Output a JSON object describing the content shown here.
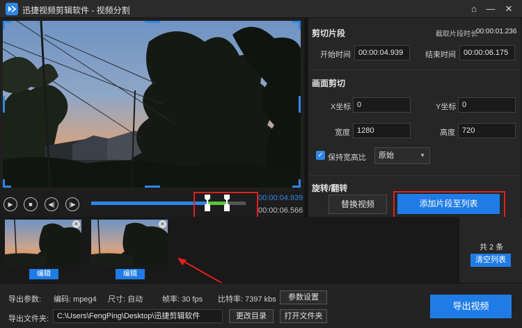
{
  "app": {
    "title": "迅捷视频剪辑软件 - 视频分割",
    "controls": {
      "home_icon": "⌂",
      "min_icon": "—",
      "close_icon": "✕"
    }
  },
  "player": {
    "current_time": "00:00:04.939",
    "end_time": "00:00:06.566",
    "trim_range": {
      "start_fraction": 0.75,
      "end_fraction": 0.88
    }
  },
  "clip_section": {
    "title": "剪切片段",
    "duration_label": "截取片段时长",
    "duration_value": "00:00:01.236",
    "start_label": "开始时间",
    "start_value": "00:00:04.939",
    "end_label": "结束时间",
    "end_value": "00:00:06.175"
  },
  "crop_section": {
    "title": "画面剪切",
    "x_label": "X坐标",
    "x_value": "0",
    "y_label": "Y坐标",
    "y_value": "0",
    "width_label": "宽度",
    "width_value": "1280",
    "height_label": "高度",
    "height_value": "720",
    "keep_ratio_label": "保持宽高比",
    "keep_ratio_checked": true,
    "ratio_select": "原始"
  },
  "rotate_section": {
    "title": "旋转/翻转"
  },
  "buttons": {
    "replace_video": "替换视频",
    "add_clip": "添加片段至列表",
    "clear_list": "清空列表",
    "param_settings": "参数设置",
    "change_dir": "更改目录",
    "open_folder": "打开文件夹",
    "export_video": "导出视频"
  },
  "thumbnails": [
    {
      "edit_label": "编辑"
    },
    {
      "edit_label": "编辑"
    }
  ],
  "list_count": "共 2 条",
  "export": {
    "params_label": "导出参数:",
    "codec": "编码: mpeg4",
    "size": "尺寸: 自动",
    "fps": "帧率: 30 fps",
    "bitrate": "比特率: 7397 kbs",
    "folder_label": "导出文件夹:",
    "folder_path": "C:\\Users\\FengPing\\Desktop\\迅捷剪辑软件"
  },
  "colors": {
    "accent": "#1f7ce6",
    "highlight": "#e0201e",
    "trim": "#5dc33a"
  }
}
